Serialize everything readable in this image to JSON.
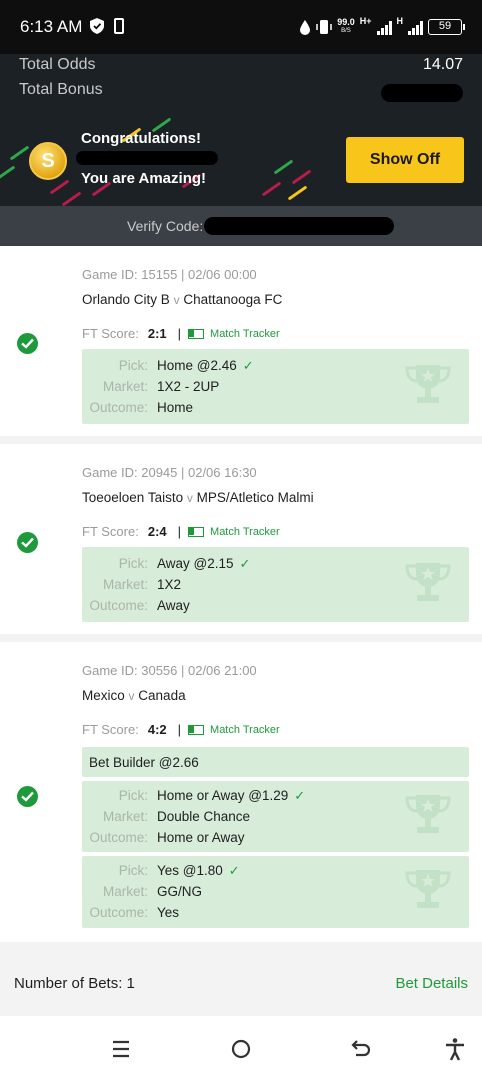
{
  "status_bar": {
    "time": "6:13 AM",
    "speed_value": "99.0",
    "speed_unit": "B/S",
    "net1": "H+",
    "net2": "H",
    "battery": "59"
  },
  "summary": {
    "total_odds_label": "Total Odds",
    "total_odds_value": "14.07",
    "total_bonus_label": "Total Bonus"
  },
  "banner": {
    "coin_symbol": "S",
    "congrats": "Congratulations!",
    "amazing": "You are Amazing!",
    "show_off": "Show Off",
    "verify_label": "Verify Code:"
  },
  "bets": [
    {
      "game_line": "Game ID: 15155 | 02/06 00:00",
      "home": "Orlando City B",
      "away": "Chattanooga FC",
      "vs": "v",
      "ft_label": "FT Score:",
      "score": "2:1",
      "sep": "|",
      "tracker": "Match Tracker",
      "picks": [
        {
          "pick_label": "Pick:",
          "pick": "Home @2.46",
          "market_label": "Market:",
          "market": "1X2 - 2UP",
          "outcome_label": "Outcome:",
          "outcome": "Home"
        }
      ]
    },
    {
      "game_line": "Game ID: 20945 | 02/06 16:30",
      "home": "Toeoeloen Taisto",
      "away": "MPS/Atletico Malmi",
      "vs": "v",
      "ft_label": "FT Score:",
      "score": "2:4",
      "sep": "|",
      "tracker": "Match Tracker",
      "picks": [
        {
          "pick_label": "Pick:",
          "pick": "Away @2.15",
          "market_label": "Market:",
          "market": "1X2",
          "outcome_label": "Outcome:",
          "outcome": "Away"
        }
      ]
    },
    {
      "game_line": "Game ID: 30556 | 02/06 21:00",
      "home": "Mexico",
      "away": "Canada",
      "vs": "v",
      "ft_label": "FT Score:",
      "score": "4:2",
      "sep": "|",
      "tracker": "Match Tracker",
      "builder": "Bet Builder @2.66",
      "picks": [
        {
          "pick_label": "Pick:",
          "pick": "Home or Away @1.29",
          "market_label": "Market:",
          "market": "Double Chance",
          "outcome_label": "Outcome:",
          "outcome": "Home or Away"
        },
        {
          "pick_label": "Pick:",
          "pick": "Yes @1.80",
          "market_label": "Market:",
          "market": "GG/NG",
          "outcome_label": "Outcome:",
          "outcome": "Yes"
        }
      ]
    }
  ],
  "footer": {
    "number_of_bets": "Number of Bets: 1",
    "bet_details": "Bet Details"
  },
  "colors": {
    "accent_green": "#1e9a3c",
    "show_off_yellow": "#f8c61b",
    "header_dark": "#1c2126",
    "pick_bg": "#d7ecd9"
  }
}
